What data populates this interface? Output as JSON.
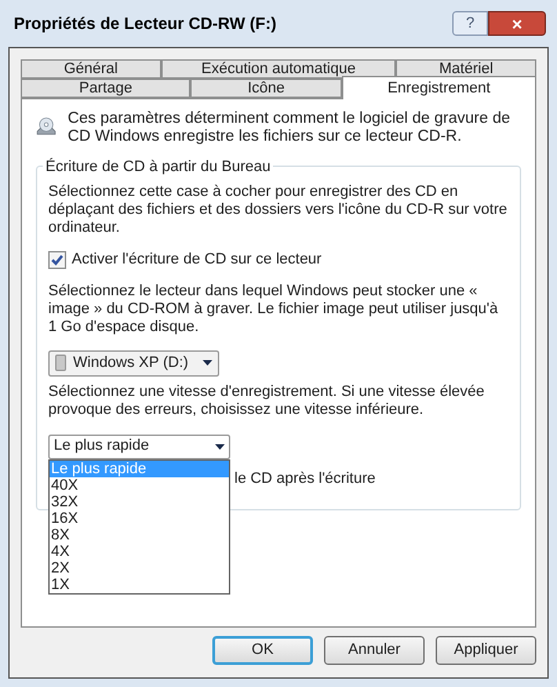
{
  "window": {
    "title": "Propriétés de Lecteur CD-RW (F:)",
    "help_button": "?",
    "close_button": "×"
  },
  "tab_rows": [
    [
      {
        "label": "Général",
        "selected": false
      },
      {
        "label": "Exécution automatique",
        "selected": false
      },
      {
        "label": "Matériel",
        "selected": false
      }
    ],
    [
      {
        "label": "Partage",
        "selected": false
      },
      {
        "label": "Icône",
        "selected": false
      },
      {
        "label": "Enregistrement",
        "selected": true
      }
    ]
  ],
  "intro": "Ces paramètres déterminent comment le logiciel de gravure de CD Windows enregistre les fichiers sur ce lecteur CD-R.",
  "group": {
    "title": "Écriture de CD à partir du Bureau",
    "description": "Sélectionnez cette case à cocher pour enregistrer des CD en déplaçant des fichiers et des dossiers vers l'icône du CD-R sur votre ordinateur.",
    "enable_checkbox": {
      "label": "Activer l'écriture de CD sur ce lecteur",
      "checked": true
    },
    "drive_description": "Sélectionnez le lecteur dans lequel Windows peut stocker une « image » du CD-ROM à graver. Le fichier image peut utiliser jusqu'à 1 Go d'espace disque.",
    "drive_select": {
      "value": "Windows XP (D:)"
    },
    "speed_description": "Sélectionnez une vitesse d'enregistrement. Si une vitesse élevée provoque des erreurs, choisissez une vitesse inférieure.",
    "speed_select": {
      "value": "Le plus rapide",
      "expanded": true,
      "options": [
        {
          "label": "Le plus rapide",
          "selected": true
        },
        {
          "label": "40X",
          "selected": false
        },
        {
          "label": "32X",
          "selected": false
        },
        {
          "label": "16X",
          "selected": false
        },
        {
          "label": "8X",
          "selected": false
        },
        {
          "label": "4X",
          "selected": false
        },
        {
          "label": "2X",
          "selected": false
        },
        {
          "label": "1X",
          "selected": false
        }
      ]
    },
    "eject_label": "le CD après l'écriture"
  },
  "buttons": [
    {
      "label": "OK",
      "default": true
    },
    {
      "label": "Annuler",
      "default": false
    },
    {
      "label": "Appliquer",
      "default": false
    }
  ]
}
